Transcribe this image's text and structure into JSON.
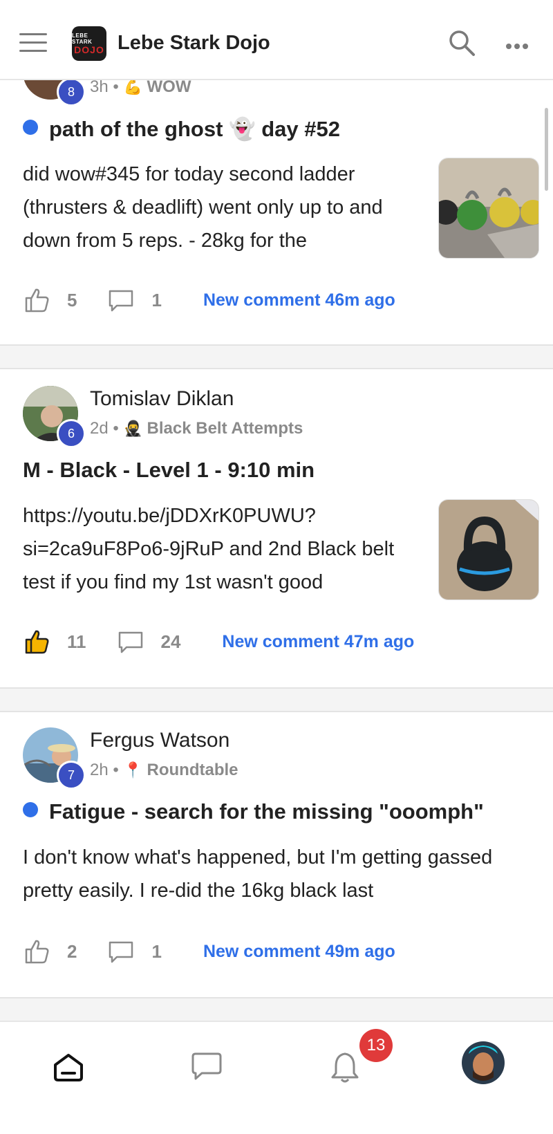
{
  "app": {
    "title": "Lebe Stark Dojo",
    "logo_line1": "LEBE STARK",
    "logo_line2": "DOJO"
  },
  "posts": [
    {
      "level": "8",
      "time": "3h",
      "separator": "•",
      "category_icon": "💪",
      "category": "WOW",
      "title": "path of the ghost 👻 day #52",
      "unread": true,
      "body": "did wow#345 for today second ladder (thrusters & deadlift) went only up to and down from 5 reps. - 28kg for the",
      "likes": "5",
      "comments": "1",
      "new_comment": "New comment 46m ago",
      "liked": false
    },
    {
      "author": "Tomislav Diklan",
      "level": "6",
      "time": "2d",
      "separator": "•",
      "category_icon": "🥷",
      "category": "Black Belt Attempts",
      "title": "M - Black - Level 1 - 9:10 min",
      "unread": false,
      "body": "https://youtu.be/jDDXrK0PUWU?si=2ca9uF8Po6-9jRuP and 2nd Black belt test if you find my 1st wasn't good",
      "likes": "11",
      "comments": "24",
      "new_comment": "New comment 47m ago",
      "liked": true
    },
    {
      "author": "Fergus Watson",
      "level": "7",
      "time": "2h",
      "separator": "•",
      "category_icon": "📍",
      "category": "Roundtable",
      "title": "Fatigue - search for the missing \"ooomph\"",
      "unread": true,
      "body": "I don't know what's happened, but I'm getting gassed pretty easily. I re-did the 16kg black last",
      "likes": "2",
      "comments": "1",
      "new_comment": "New comment 49m ago",
      "liked": false
    }
  ],
  "nav": {
    "notification_count": "13",
    "items": [
      "home-icon",
      "chat-icon",
      "bell-icon",
      "profile-avatar"
    ]
  },
  "colors": {
    "accent": "#2f6fe8",
    "badge": "#3a4fc2",
    "notif": "#e03a3a",
    "like_active": "#f5b400"
  }
}
